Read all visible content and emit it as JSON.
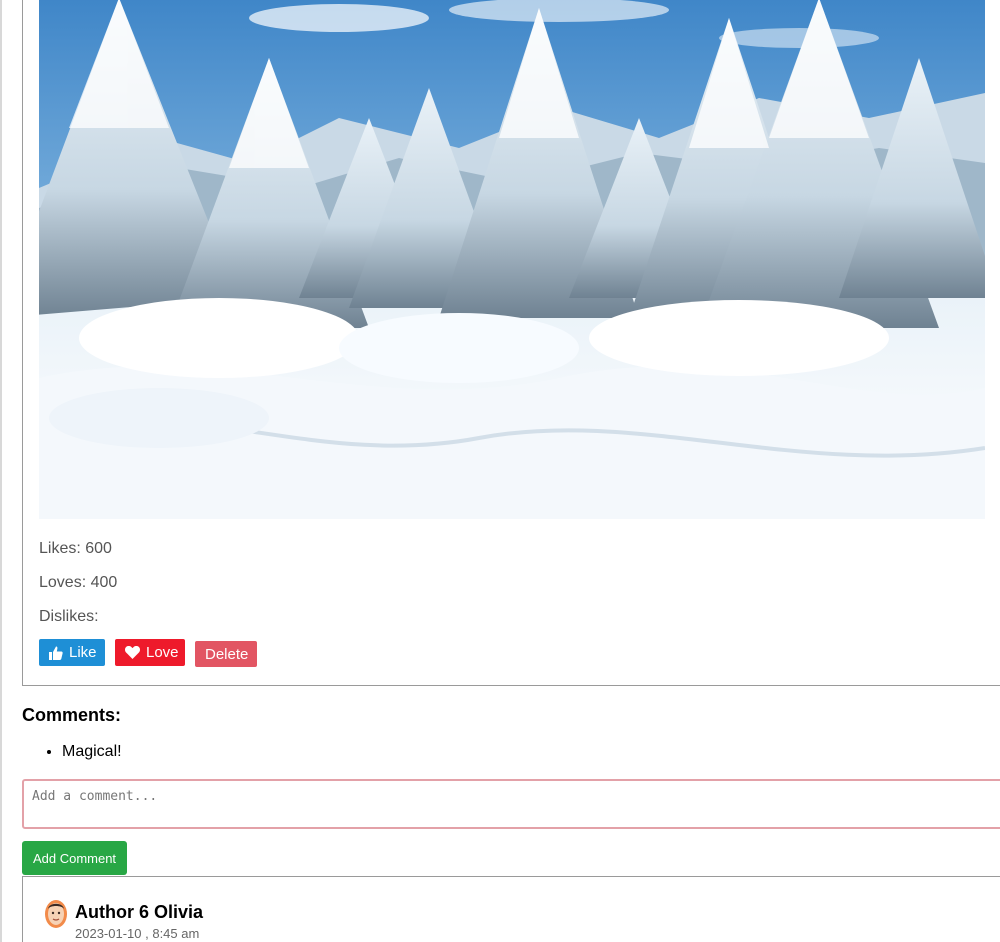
{
  "post": {
    "image_alt": "Snow-covered evergreen forest with mountains",
    "likes_text": "Likes: 600",
    "loves_text": "Loves: 400",
    "dislikes_text": "Dislikes:",
    "buttons": {
      "like_label": "Like",
      "love_label": "Love",
      "delete_label": "Delete"
    }
  },
  "comments": {
    "title": "Comments:",
    "items": [
      "Magical!"
    ],
    "input_placeholder": "Add a comment...",
    "add_button_label": "Add Comment"
  },
  "next_post": {
    "author_name": "Author 6 Olivia",
    "date": "2023-01-10 , 8:45 am"
  },
  "colors": {
    "like": "#1e8fd6",
    "love": "#ee1a2b",
    "delete": "#e25563",
    "add_comment": "#28a745"
  },
  "icons": {
    "like": "thumbs-up-icon",
    "love": "heart-icon"
  }
}
